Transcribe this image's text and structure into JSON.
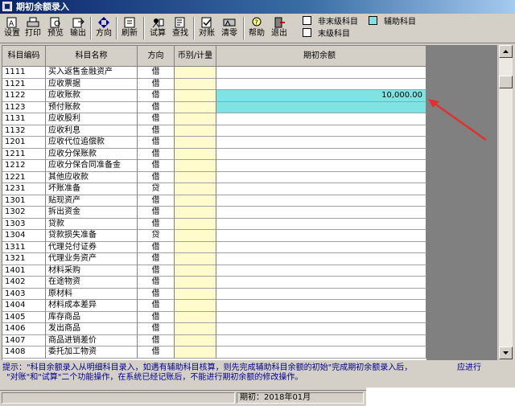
{
  "window": {
    "title": "期初余额录入"
  },
  "toolbar": {
    "buttons": [
      {
        "label": "设置",
        "icon": "settings-icon"
      },
      {
        "label": "打印",
        "icon": "print-icon"
      },
      {
        "label": "预览",
        "icon": "preview-icon"
      },
      {
        "label": "输出",
        "icon": "export-icon"
      },
      {
        "label": "方向",
        "icon": "direction-icon"
      },
      {
        "label": "刷新",
        "icon": "refresh-icon"
      },
      {
        "label": "试算",
        "icon": "calculate-icon"
      },
      {
        "label": "查找",
        "icon": "find-icon"
      },
      {
        "label": "对账",
        "icon": "reconcile-icon"
      },
      {
        "label": "清零",
        "icon": "clear-icon"
      },
      {
        "label": "帮助",
        "icon": "help-icon"
      },
      {
        "label": "退出",
        "icon": "exit-icon"
      }
    ]
  },
  "legend": {
    "non_leaf": "非末级科目",
    "auxiliary": "辅助科目",
    "leaf": "末级科目",
    "auxiliary_color": "#7fe3e3"
  },
  "table": {
    "headers": [
      "科目编码",
      "科目名称",
      "方向",
      "币别/计量",
      "期初余额"
    ],
    "rows": [
      {
        "code": "1111",
        "name": "买入返售金融资产",
        "dir": "借",
        "cur": "",
        "bal": ""
      },
      {
        "code": "1121",
        "name": "应收票据",
        "dir": "借",
        "cur": "",
        "bal": ""
      },
      {
        "code": "1122",
        "name": "应收账款",
        "dir": "借",
        "cur": "",
        "bal": "10,000.00"
      },
      {
        "code": "1123",
        "name": "预付账款",
        "dir": "借",
        "cur": "",
        "bal": ""
      },
      {
        "code": "1131",
        "name": "应收股利",
        "dir": "借",
        "cur": "",
        "bal": ""
      },
      {
        "code": "1132",
        "name": "应收利息",
        "dir": "借",
        "cur": "",
        "bal": ""
      },
      {
        "code": "1201",
        "name": "应收代位追偿款",
        "dir": "借",
        "cur": "",
        "bal": ""
      },
      {
        "code": "1211",
        "name": "应收分保账款",
        "dir": "借",
        "cur": "",
        "bal": ""
      },
      {
        "code": "1212",
        "name": "应收分保合同准备金",
        "dir": "借",
        "cur": "",
        "bal": ""
      },
      {
        "code": "1221",
        "name": "其他应收款",
        "dir": "借",
        "cur": "",
        "bal": ""
      },
      {
        "code": "1231",
        "name": "坏账准备",
        "dir": "贷",
        "cur": "",
        "bal": ""
      },
      {
        "code": "1301",
        "name": "贴现资产",
        "dir": "借",
        "cur": "",
        "bal": ""
      },
      {
        "code": "1302",
        "name": "拆出资金",
        "dir": "借",
        "cur": "",
        "bal": ""
      },
      {
        "code": "1303",
        "name": "贷款",
        "dir": "借",
        "cur": "",
        "bal": ""
      },
      {
        "code": "1304",
        "name": "贷款损失准备",
        "dir": "贷",
        "cur": "",
        "bal": ""
      },
      {
        "code": "1311",
        "name": "代理兑付证券",
        "dir": "借",
        "cur": "",
        "bal": ""
      },
      {
        "code": "1321",
        "name": "代理业务资产",
        "dir": "借",
        "cur": "",
        "bal": ""
      },
      {
        "code": "1401",
        "name": "材料采购",
        "dir": "借",
        "cur": "",
        "bal": ""
      },
      {
        "code": "1402",
        "name": "在途物资",
        "dir": "借",
        "cur": "",
        "bal": ""
      },
      {
        "code": "1403",
        "name": "原材料",
        "dir": "借",
        "cur": "",
        "bal": ""
      },
      {
        "code": "1404",
        "name": "材料成本差异",
        "dir": "借",
        "cur": "",
        "bal": ""
      },
      {
        "code": "1405",
        "name": "库存商品",
        "dir": "借",
        "cur": "",
        "bal": ""
      },
      {
        "code": "1406",
        "name": "发出商品",
        "dir": "借",
        "cur": "",
        "bal": ""
      },
      {
        "code": "1407",
        "name": "商品进销差价",
        "dir": "借",
        "cur": "",
        "bal": ""
      },
      {
        "code": "1408",
        "name": "委托加工物资",
        "dir": "借",
        "cur": "",
        "bal": ""
      }
    ]
  },
  "hint": {
    "line1": "提示：\"科目余额录入从明细科目录入，如遇有辅助科目核算，则先完成辅助科目余额的初始\"完成期初余额录入后，",
    "line1_right": "应进行",
    "line2": "\"对账\"和\"试算\"二个功能操作，在系统已经记账后，不能进行期初余额的修改操作。"
  },
  "status": {
    "period": "期初：2018年01月"
  }
}
